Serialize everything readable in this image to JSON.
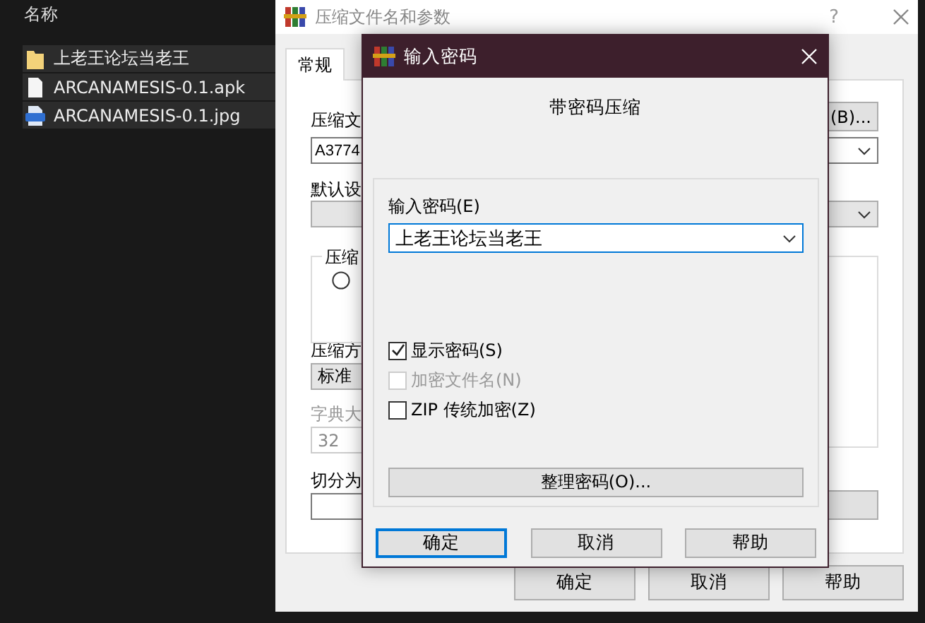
{
  "explorer": {
    "column_header": "名称",
    "items": [
      {
        "name": "上老王论坛当老王",
        "kind": "folder"
      },
      {
        "name": "ARCANAMESIS-0.1.apk",
        "kind": "file"
      },
      {
        "name": "ARCANAMESIS-0.1.jpg",
        "kind": "image"
      }
    ]
  },
  "archive_dialog": {
    "title": "压缩文件名和参数",
    "help": "?",
    "tabs": [
      {
        "label": "常规",
        "selected": true
      }
    ],
    "archive_name_label": "压缩文",
    "browse_button": "(B)...",
    "archive_name": "A3774",
    "profile_label": "默认设",
    "format_group_label": "压缩",
    "format_option": {
      "selected": false
    },
    "method_label": "压缩方",
    "method": "标准",
    "dictionary_label": "字典大",
    "dictionary": "32",
    "split_label": "切分为",
    "buttons": [
      "确定",
      "取消",
      "帮助"
    ]
  },
  "password_dialog": {
    "title": "输入密码",
    "heading": "带密码压缩",
    "password_label": "输入密码(E)",
    "password": "上老王论坛当老王",
    "options": [
      {
        "label": "显示密码(S)",
        "checked": true,
        "disabled": false
      },
      {
        "label": "加密文件名(N)",
        "checked": false,
        "disabled": true
      },
      {
        "label": "ZIP 传统加密(Z)",
        "checked": false,
        "disabled": false
      }
    ],
    "organize_button": "整理密码(O)...",
    "buttons": [
      {
        "label": "确定",
        "default": true
      },
      {
        "label": "取消",
        "default": false
      },
      {
        "label": "帮助",
        "default": false
      }
    ]
  }
}
